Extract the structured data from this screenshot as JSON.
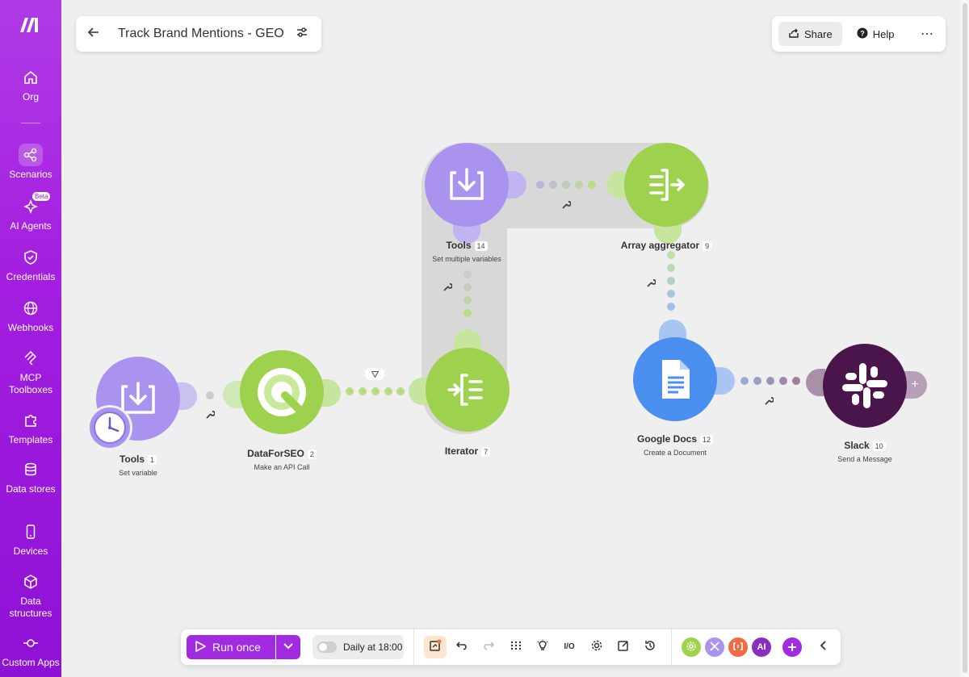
{
  "sidebar": {
    "items": [
      {
        "label": "Org",
        "icon": "home-icon"
      },
      {
        "label": "Scenarios",
        "icon": "share-nodes-icon"
      },
      {
        "label": "AI Agents",
        "icon": "sparkle-icon",
        "badge": "Beta"
      },
      {
        "label": "Credentials",
        "icon": "shield-icon"
      },
      {
        "label": "Webhooks",
        "icon": "globe-icon"
      },
      {
        "label": "MCP Toolboxes",
        "icon": "mcp-icon"
      },
      {
        "label": "Templates",
        "icon": "puzzle-icon"
      },
      {
        "label": "Data stores",
        "icon": "database-icon"
      },
      {
        "label": "Devices",
        "icon": "phone-icon"
      },
      {
        "label": "Data structures",
        "icon": "cube-icon"
      },
      {
        "label": "Custom Apps",
        "icon": "plug-icon"
      }
    ]
  },
  "header": {
    "title": "Track Brand Mentions - GEO",
    "share_label": "Share",
    "help_label": "Help"
  },
  "nodes": {
    "tools1": {
      "name": "Tools",
      "num": "1",
      "sub": "Set variable"
    },
    "dataforseo": {
      "name": "DataForSEO",
      "num": "2",
      "sub": "Make an API Call"
    },
    "iterator": {
      "name": "Iterator",
      "num": "7"
    },
    "tools14": {
      "name": "Tools",
      "num": "14",
      "sub": "Set multiple variables"
    },
    "aggregator": {
      "name": "Array aggregator",
      "num": "9"
    },
    "gdocs": {
      "name": "Google Docs",
      "num": "12",
      "sub": "Create a Document"
    },
    "slack": {
      "name": "Slack",
      "num": "10",
      "sub": "Send a Message"
    }
  },
  "toolbar": {
    "run_label": "Run once",
    "schedule_label": "Daily at 18:00",
    "ai_label": "AI"
  },
  "colors": {
    "brand": "#a22be2",
    "tools": "#a993ee",
    "green": "#a6d96a",
    "gdocs": "#4a8ff0",
    "slack": "#4a154b"
  }
}
